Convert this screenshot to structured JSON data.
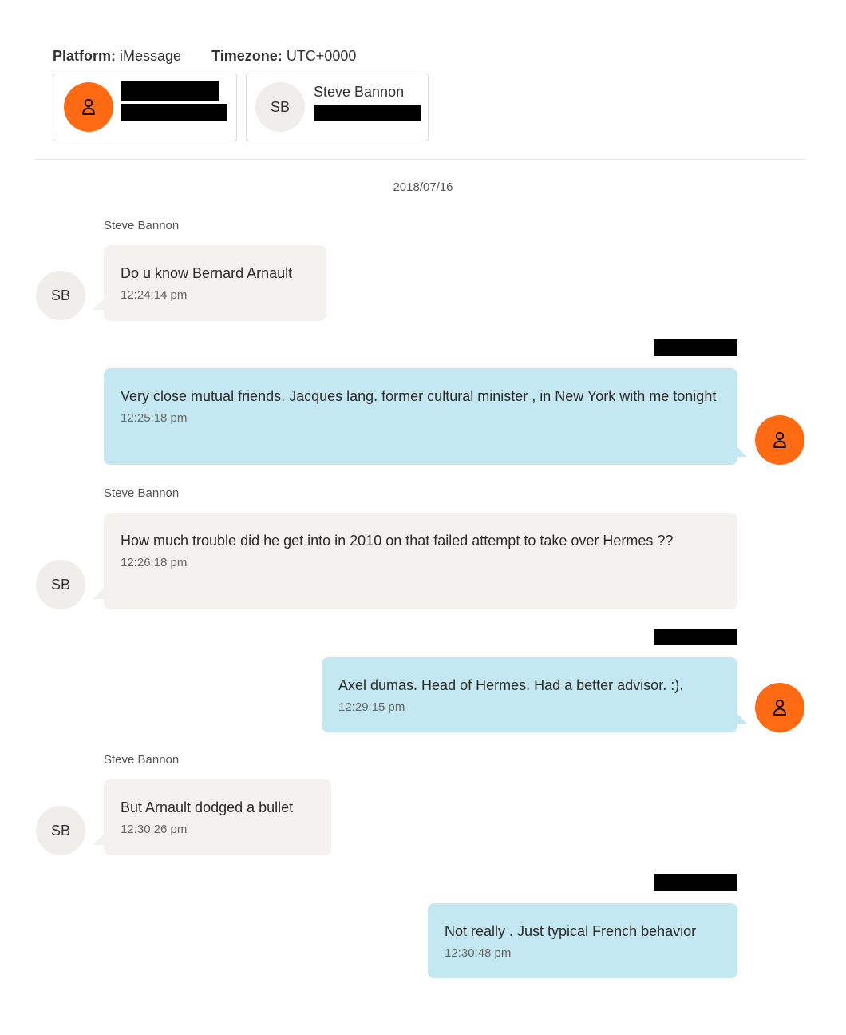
{
  "header": {
    "platform_label": "Platform:",
    "platform_value": "iMessage",
    "timezone_label": "Timezone:",
    "timezone_value": "UTC+0000"
  },
  "participants": [
    {
      "avatar_icon": "person-icon",
      "name": "",
      "redacted": true
    },
    {
      "initials": "SB",
      "name": "Steve Bannon",
      "redacted_detail": true
    }
  ],
  "date_separator": "2018/07/16",
  "messages": [
    {
      "direction": "incoming",
      "sender": "Steve Bannon",
      "initials": "SB",
      "text": "Do u know Bernard Arnault",
      "time": "12:24:14 pm"
    },
    {
      "direction": "outgoing",
      "sender_redacted": true,
      "text": "Very close mutual friends.   Jacques lang.  former cultural minister ,  in New York with me tonight",
      "time": "12:25:18 pm"
    },
    {
      "direction": "incoming",
      "sender": "Steve Bannon",
      "initials": "SB",
      "text": "How much trouble did he get into in 2010 on that failed attempt to take over Hermes ??",
      "time": "12:26:18 pm"
    },
    {
      "direction": "outgoing",
      "sender_redacted": true,
      "text": "Axel dumas. Head of Hermes.  Had  a better advisor.  :).",
      "time": "12:29:15 pm"
    },
    {
      "direction": "incoming",
      "sender": "Steve Bannon",
      "initials": "SB",
      "text": "But Arnault dodged a bullet",
      "time": "12:30:26 pm"
    },
    {
      "direction": "outgoing",
      "sender_redacted": true,
      "text": "Not really .   Just typical French behavior",
      "time": "12:30:48 pm"
    }
  ],
  "colors": {
    "accent_orange": "#ff6a13",
    "incoming_bubble": "#f3f2ef",
    "outgoing_bubble": "#c4e8f2"
  }
}
